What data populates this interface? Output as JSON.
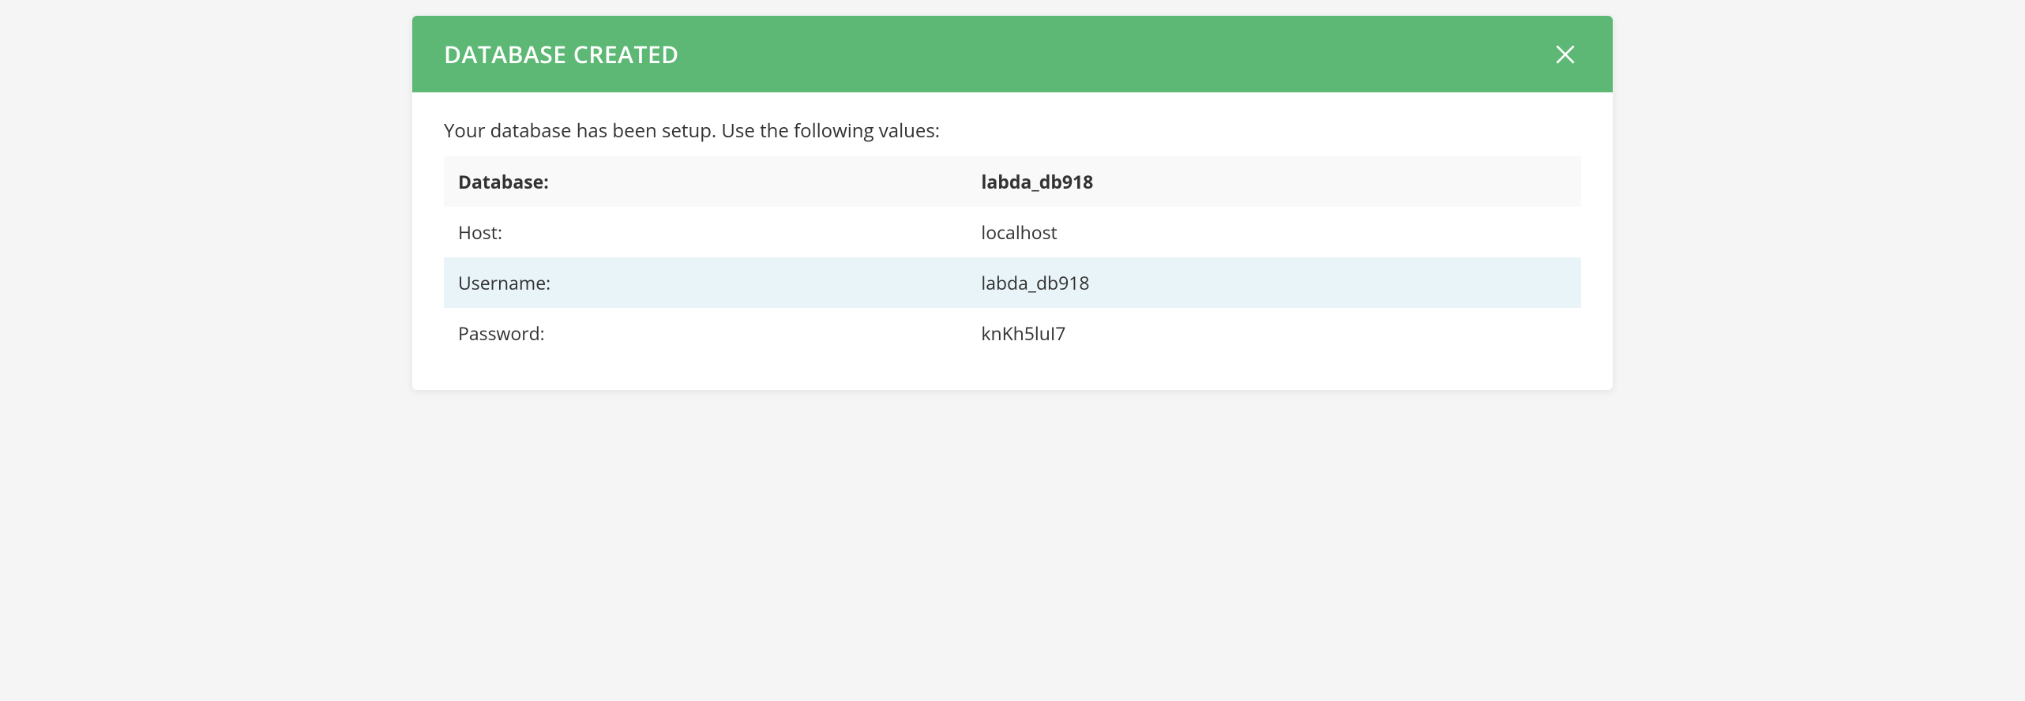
{
  "modal": {
    "title": "DATABASE CREATED",
    "intro": "Your database has been setup. Use the following values:",
    "rows": [
      {
        "label": "Database:",
        "value": "labda_db918"
      },
      {
        "label": "Host:",
        "value": "localhost"
      },
      {
        "label": "Username:",
        "value": "labda_db918"
      },
      {
        "label": "Password:",
        "value": "knKh5luI7"
      }
    ]
  }
}
